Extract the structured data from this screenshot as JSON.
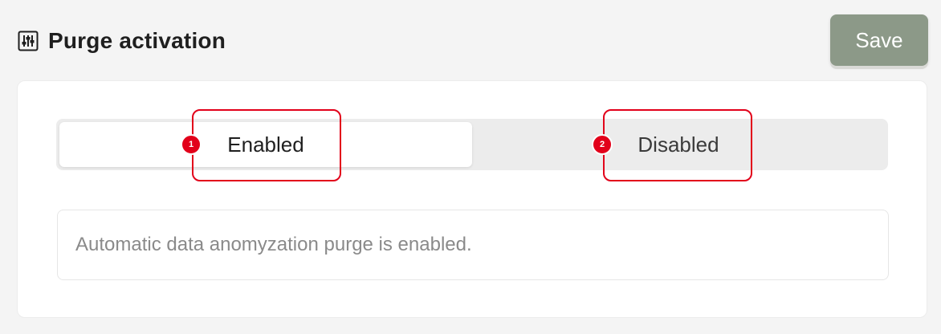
{
  "header": {
    "icon": "sliders-icon",
    "title": "Purge activation"
  },
  "toolbar": {
    "save_label": "Save"
  },
  "colors": {
    "accent": "#8c9988",
    "marker": "#e2001a"
  },
  "activation_toggle": {
    "options": [
      {
        "label": "Enabled",
        "selected": true,
        "marker": "1"
      },
      {
        "label": "Disabled",
        "selected": false,
        "marker": "2"
      }
    ]
  },
  "status": {
    "message": "Automatic data anomyzation purge is enabled."
  }
}
